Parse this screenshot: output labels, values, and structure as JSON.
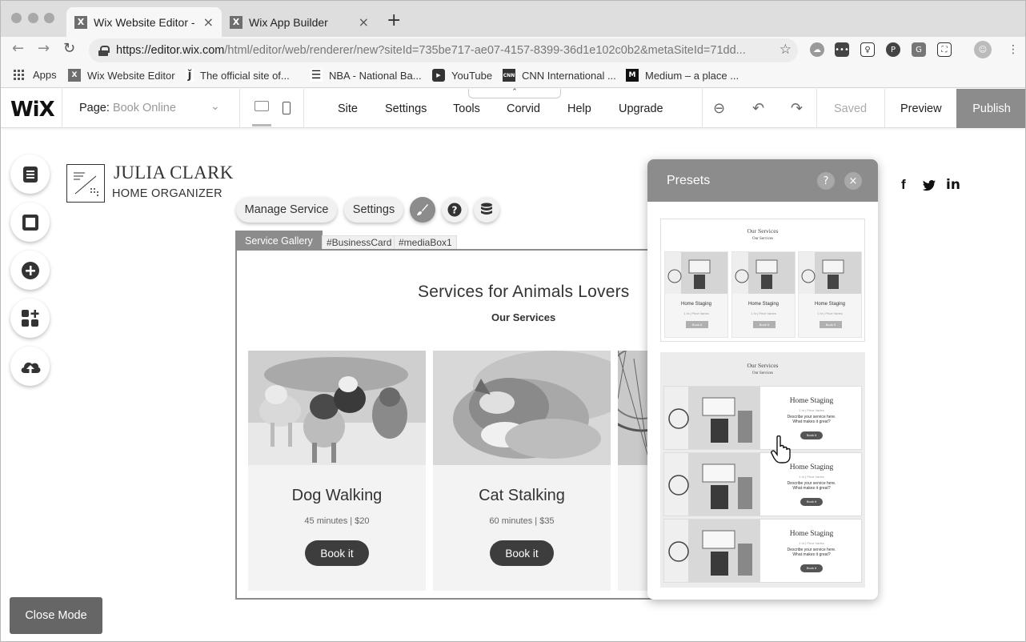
{
  "browser": {
    "tabs": [
      {
        "label": "Wix Website Editor - m",
        "favicon": "X",
        "active": true
      },
      {
        "label": "Wix App Builder",
        "favicon": "X",
        "active": false
      }
    ],
    "new_tab": "+",
    "url_host": "https://editor.wix.com",
    "url_path": "/html/editor/web/renderer/new?siteId=735be717-ae07-4157-8399-36d1e102c0b2&metaSiteId=71dd...",
    "bookmarks": [
      {
        "label": "Apps",
        "icon": "apps-grid-icon"
      },
      {
        "label": "Wix Website Editor",
        "icon": "X"
      },
      {
        "label": "The official site of...",
        "icon": "nba-icon"
      },
      {
        "label": "NBA - National Ba...",
        "icon": "nba-flag-icon"
      },
      {
        "label": "YouTube",
        "icon": "youtube-icon"
      },
      {
        "label": "CNN International ...",
        "icon": "CNN"
      },
      {
        "label": "Medium – a place ...",
        "icon": "M"
      }
    ]
  },
  "editor": {
    "logo": "WiX",
    "page_label": "Page:",
    "page_name": "Book Online",
    "menu": [
      "Site",
      "Settings",
      "Tools",
      "Corvid",
      "Help",
      "Upgrade"
    ],
    "saved": "Saved",
    "preview": "Preview",
    "publish": "Publish",
    "collapse_glyph": "⌃"
  },
  "site": {
    "name": "JULIA CLARK",
    "tagline": "HOME ORGANIZER"
  },
  "component_toolbar": {
    "manage": "Manage Service",
    "settings": "Settings",
    "tag": "Service Gallery",
    "ids": [
      "#BusinessCard",
      "#mediaBox1"
    ]
  },
  "gallery": {
    "title": "Services for Animals Lovers",
    "subtitle": "Our Services",
    "cards": [
      {
        "title": "Dog Walking",
        "meta": "45 minutes  |  $20",
        "button": "Book it"
      },
      {
        "title": "Cat Stalking",
        "meta": "60 minutes  |  $35",
        "button": "Book it"
      }
    ]
  },
  "presets": {
    "title": "Presets",
    "help": "?",
    "close": "×",
    "preset1": {
      "title": "Our Services",
      "subtitle": "Our Services",
      "items": [
        {
          "label": "Home Staging",
          "sub": "1 hr  |  Price Varies",
          "button": "Book It"
        },
        {
          "label": "Home Staging",
          "sub": "1 hr  |  Price Varies",
          "button": "Book It"
        },
        {
          "label": "Home Staging",
          "sub": "1 hr  |  Price Varies",
          "button": "Book It"
        }
      ]
    },
    "preset2": {
      "title": "Our Services",
      "subtitle": "Our Services",
      "rows": [
        {
          "title": "Home Staging",
          "sub": "1 hr  |  Price Varies",
          "desc1": "Describe your service here.",
          "desc2": "What makes it great?",
          "button": "Book it"
        },
        {
          "title": "Home Staging",
          "sub": "1 hr  |  Price Varies",
          "desc1": "Describe your service here.",
          "desc2": "What makes it great?",
          "button": "Book it"
        },
        {
          "title": "Home Staging",
          "sub": "1 hr  |  Price Varies",
          "desc1": "Describe your service here.",
          "desc2": "What makes it great?",
          "button": "Book it"
        }
      ]
    }
  },
  "social": [
    "f",
    "t",
    "in"
  ],
  "close_mode": "Close Mode",
  "colors": {
    "publish_bg": "#8c8c8c",
    "panel_header": "#8c8c8c",
    "book_button": "#3d3d3d",
    "close_mode_bg": "#666666"
  }
}
